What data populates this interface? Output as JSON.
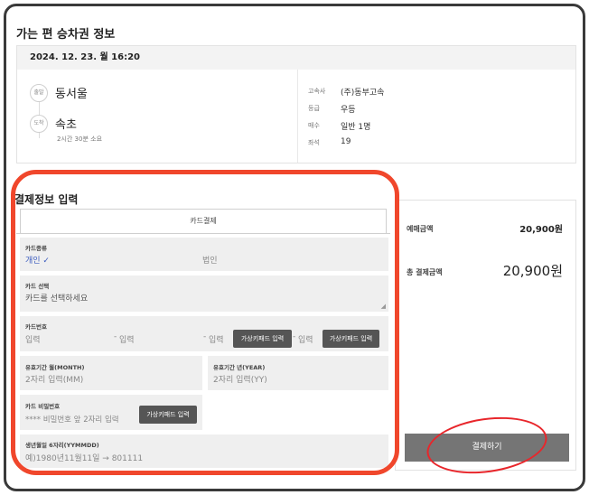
{
  "ticket": {
    "section_title": "가는 편 승차권 정보",
    "datetime": "2024. 12. 23. 월 16:20",
    "depart_badge": "출발",
    "depart": "동서울",
    "arrive_badge": "도착",
    "arrive": "속초",
    "duration": "2시간 30분 소요",
    "info": [
      {
        "key": "고속사",
        "value": "(주)동부고속"
      },
      {
        "key": "등급",
        "value": "우등"
      },
      {
        "key": "매수",
        "value": "일반 1명"
      },
      {
        "key": "좌석",
        "value": "19"
      }
    ]
  },
  "payment": {
    "title": "결제정보 입력",
    "tab": "카드결제",
    "card_type": {
      "label": "카드종류",
      "personal": "개인 ✓",
      "corporate": "법인"
    },
    "card_select": {
      "label": "카드 선택",
      "placeholder": "카드를 선택하세요"
    },
    "card_number": {
      "label": "카드번호",
      "input1": "입력",
      "input2": "입력",
      "input3": "입력",
      "input4": "입력",
      "dash": "-",
      "keypad": "가상키패드 입력"
    },
    "expiry_month": {
      "label": "유효기간 월(MONTH)",
      "placeholder": "2자리 입력(MM)"
    },
    "expiry_year": {
      "label": "유효기간 년(YEAR)",
      "placeholder": "2자리 입력(YY)"
    },
    "password": {
      "label": "카드 비밀번호",
      "placeholder": "**** 비밀번호 앞 2자리 입력",
      "keypad": "가상키패드 입력"
    },
    "birth": {
      "label": "생년월일 6자리(YYMMDD)",
      "placeholder": "예)1980년11월11일 → 801111"
    }
  },
  "summary": {
    "reserve_label": "예매금액",
    "reserve_amount": "20,900원",
    "total_label": "총 결제금액",
    "total_amount": "20,900원",
    "pay_button": "결제하기"
  },
  "colors": {
    "annotation": "#f0472c",
    "button": "#555555",
    "pay_button": "#757575"
  }
}
